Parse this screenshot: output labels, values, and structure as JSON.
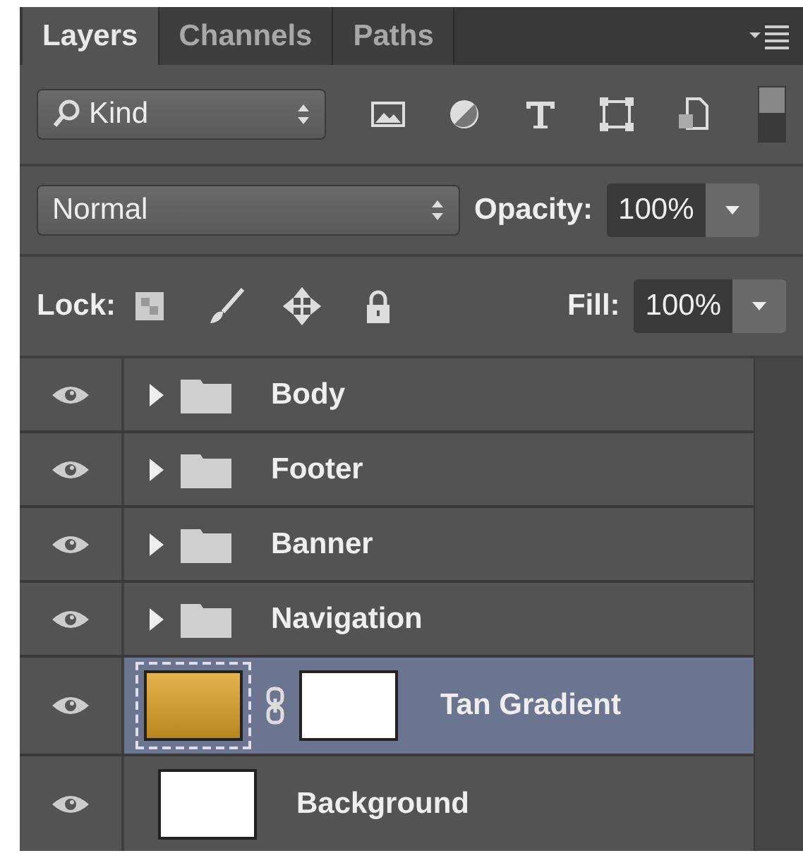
{
  "tabs": [
    {
      "label": "Layers",
      "selected": true
    },
    {
      "label": "Channels",
      "selected": false
    },
    {
      "label": "Paths",
      "selected": false
    }
  ],
  "filter": {
    "value": "Kind"
  },
  "blend": {
    "mode": "Normal",
    "opacity_label": "Opacity:",
    "opacity": "100%"
  },
  "lock": {
    "label": "Lock:",
    "fill_label": "Fill:",
    "fill": "100%"
  },
  "layers": [
    {
      "name": "Body",
      "kind": "group",
      "visible": true,
      "expanded": false,
      "selected": false
    },
    {
      "name": "Footer",
      "kind": "group",
      "visible": true,
      "expanded": false,
      "selected": false
    },
    {
      "name": "Banner",
      "kind": "group",
      "visible": true,
      "expanded": false,
      "selected": false
    },
    {
      "name": "Navigation",
      "kind": "group",
      "visible": true,
      "expanded": false,
      "selected": false
    },
    {
      "name": "Tan Gradient",
      "kind": "gradient",
      "visible": true,
      "selected": true
    },
    {
      "name": "Background",
      "kind": "background",
      "visible": true,
      "selected": false
    }
  ]
}
